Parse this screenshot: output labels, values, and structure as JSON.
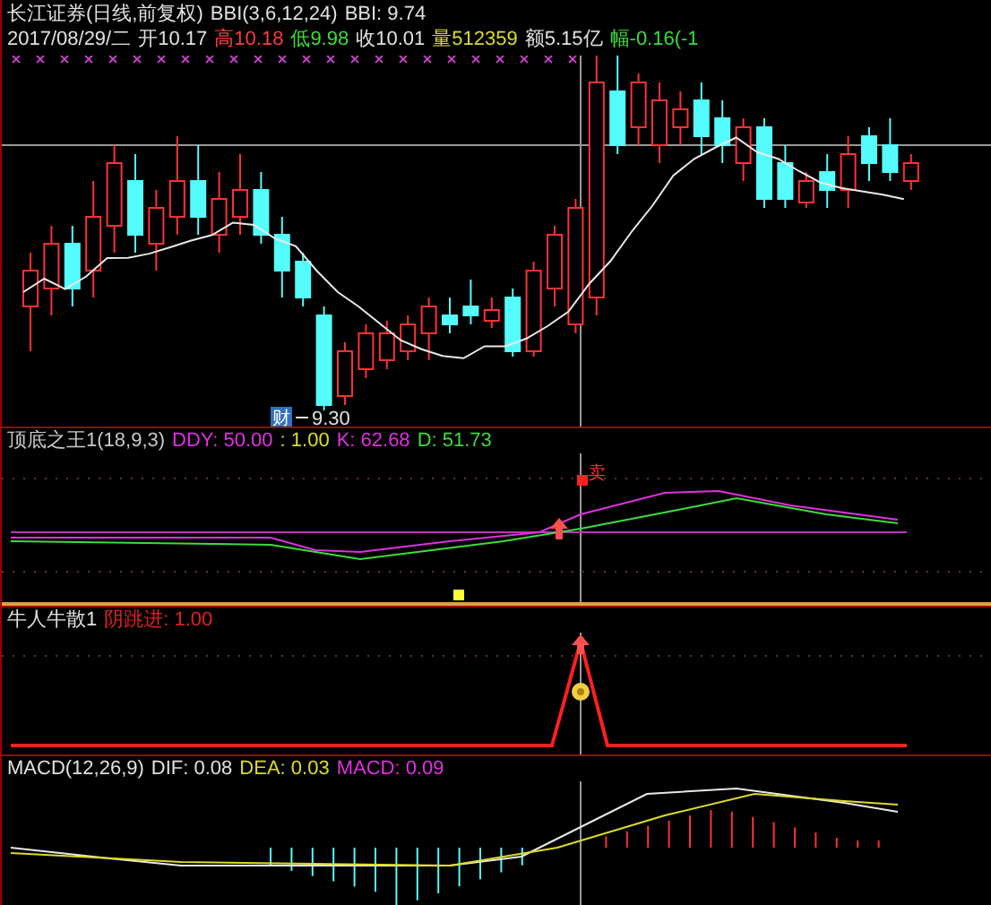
{
  "main_chart": {
    "legend": [
      {
        "text": "长江证券(日线,前复权)",
        "color": "#e0e0e0"
      },
      {
        "text": "BBI(3,6,12,24)",
        "color": "#e0e0e0"
      },
      {
        "text": "BBI: 9.74",
        "color": "#e0e0e0"
      }
    ],
    "quote": [
      {
        "text": "2017/08/29/二",
        "color": "#e0e0e0"
      },
      {
        "text": "开10.17",
        "color": "#e0e0e0"
      },
      {
        "text": "高10.18",
        "color": "#ff3c3c"
      },
      {
        "text": "低9.98",
        "color": "#3cdc3c"
      },
      {
        "text": "收10.01",
        "color": "#e0e0e0"
      },
      {
        "text": "量512359",
        "color": "#dcdc28"
      },
      {
        "text": "额5.15亿",
        "color": "#e0e0e0"
      },
      {
        "text": "幅-0.16(-1",
        "color": "#3cdc3c"
      }
    ],
    "low_marker": "9.30",
    "badge": "财"
  },
  "kdj_panel": {
    "legend": [
      {
        "text": "顶底之王1(18,9,3)",
        "color": "#c8c8c8"
      },
      {
        "text": "DDY: 50.00",
        "color": "#e030e0"
      },
      {
        "text": ": 1.00",
        "color": "#dcdc28"
      },
      {
        "text": "K: 62.68",
        "color": "#e030e0"
      },
      {
        "text": "D: 51.73",
        "color": "#3cdc3c"
      }
    ],
    "sell_marker": "卖"
  },
  "signal_panel": {
    "legend": [
      {
        "text": "牛人牛散1",
        "color": "#e0e0e0"
      },
      {
        "text": "阴跳进: 1.00",
        "color": "#e02020"
      }
    ]
  },
  "macd_panel": {
    "legend": [
      {
        "text": "MACD(12,26,9)",
        "color": "#e0e0e0"
      },
      {
        "text": "DIF: 0.08",
        "color": "#e0e0e0"
      },
      {
        "text": "DEA: 0.03",
        "color": "#dcdc28"
      },
      {
        "text": "MACD: 0.09",
        "color": "#e030e0"
      }
    ]
  }
}
